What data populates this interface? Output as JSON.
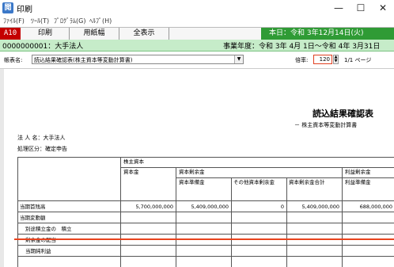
{
  "window": {
    "title": "印刷",
    "app_icon_label": "閲",
    "minimize_glyph": "—",
    "maximize_glyph": "☐",
    "close_glyph": "✕"
  },
  "menu": {
    "items": [
      "ﾌｧｲﾙ(F)",
      "ﾂｰﾙ(T)",
      "ﾌﾟﾛｸﾞﾗﾑ(G)",
      "ﾍﾙﾌﾟ(H)"
    ]
  },
  "toolbar": {
    "mode_tag": "A10",
    "print_label": "印刷",
    "paper_width_label": "用紙幅",
    "show_all_label": "全表示",
    "date_text": "本日：令和 3年12月14日(火)"
  },
  "company": {
    "code_name": "0000000001：大手法人",
    "fiscal_year": "事業年度：令和 3年 4月 1日～令和 4年 3月31日"
  },
  "options": {
    "form_label": "帳表名:",
    "form_selected": "読込結果確認表(株主資本等変動計算書)",
    "zoom_label": "倍率:",
    "zoom_value": "120",
    "page_count": "1/1 ページ"
  },
  "document": {
    "title": "読込結果確認表",
    "subtitle": "－ 株主資本等変動計算書",
    "corp_name": "法 人 名：大手法人",
    "proc_type": "処理区分：確定申告",
    "header": {
      "shareholders_equity": "株主資本",
      "capital": "資本金",
      "capital_surplus": "資本剰余金",
      "retained_earnings": "利益剰余金",
      "capital_reserve": "資本準備金",
      "other_capital_surplus": "その他資本剰余金",
      "capital_surplus_total": "資本剰余金合計",
      "legal_reserve": "利益準備金"
    },
    "rows": [
      {
        "label": "当期首残高",
        "capital": "5,700,000,000",
        "capital_reserve": "5,409,000,000",
        "other": "0",
        "surplus_total": "5,409,000,000",
        "legal_reserve": "688,000,000"
      },
      {
        "label": "当期変動額"
      },
      {
        "label": "別途積立金の　積立"
      },
      {
        "label": "剰余金の配当"
      },
      {
        "label": "当期純利益"
      }
    ]
  }
}
